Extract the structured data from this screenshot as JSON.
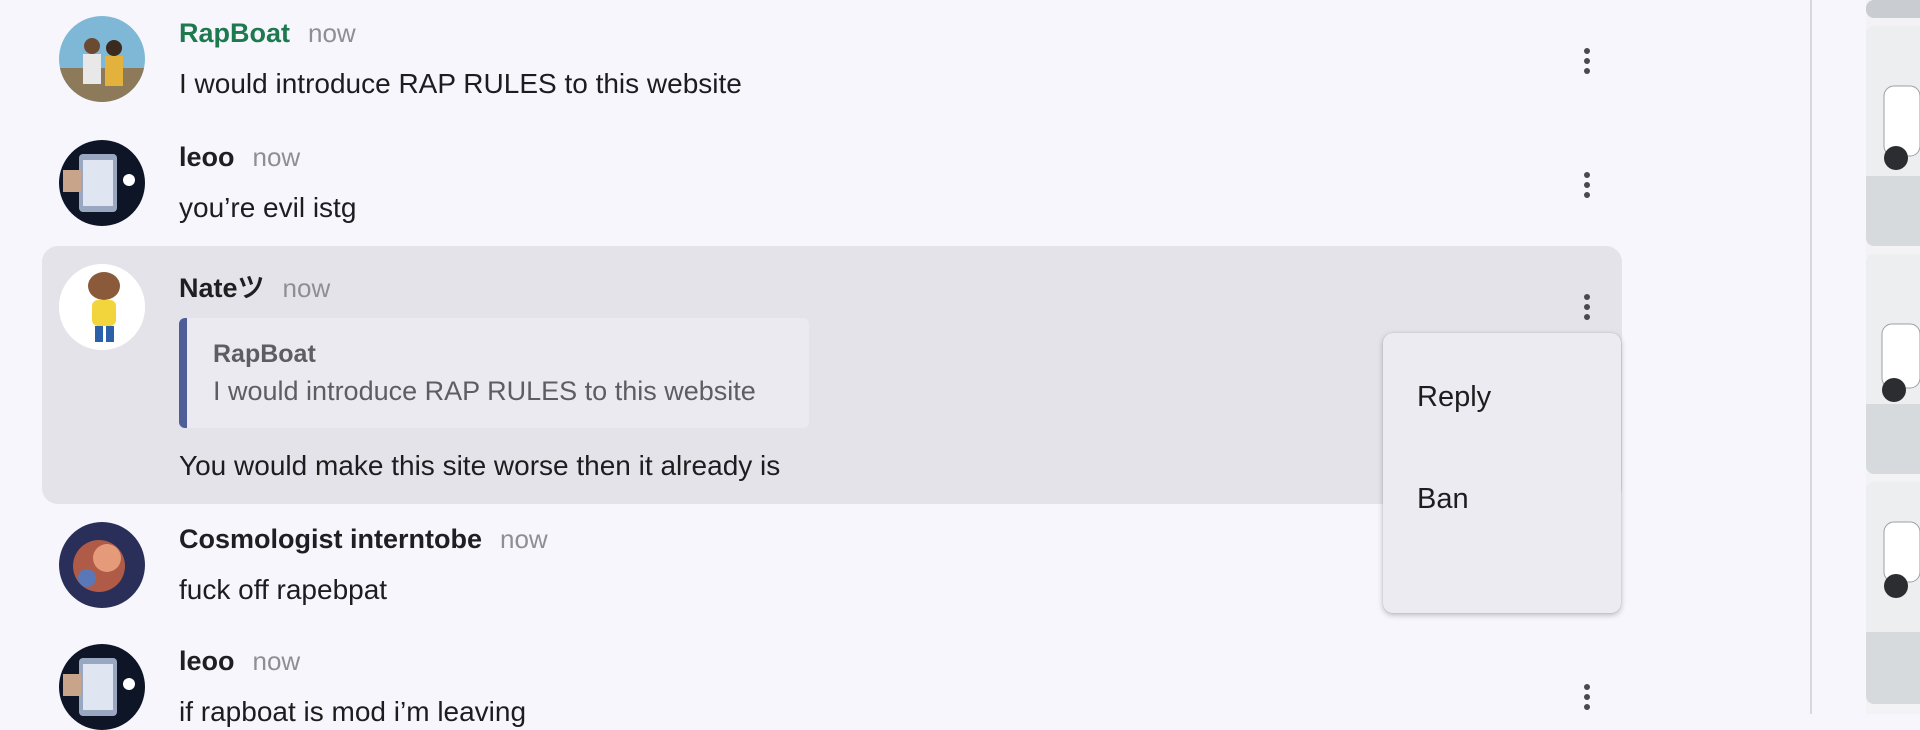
{
  "messages": [
    {
      "name": "RapBoat",
      "time": "now",
      "text": "I would introduce RAP RULES to this website"
    },
    {
      "name": "leoo",
      "time": "now",
      "text": "you’re evil istg"
    },
    {
      "name": "Nateツ",
      "time": "now",
      "reply_to": {
        "name": "RapBoat",
        "text": "I would introduce RAP RULES to this website"
      },
      "text": "You would make this site worse then it already is"
    },
    {
      "name": "Cosmologist interntobe",
      "time": "now",
      "text": "fuck off rapebpat"
    },
    {
      "name": "leoo",
      "time": "now",
      "text": "if rapboat is mod i’m leaving"
    }
  ],
  "context_menu": {
    "items": [
      "Reply",
      "Ban"
    ]
  },
  "colors": {
    "background": "#f7f6fc",
    "highlight": "#e4e3e9",
    "mod_name": "#1c7a4e",
    "quote_bar": "#4f5e99"
  },
  "icons": {
    "more": "more-vertical-icon"
  }
}
